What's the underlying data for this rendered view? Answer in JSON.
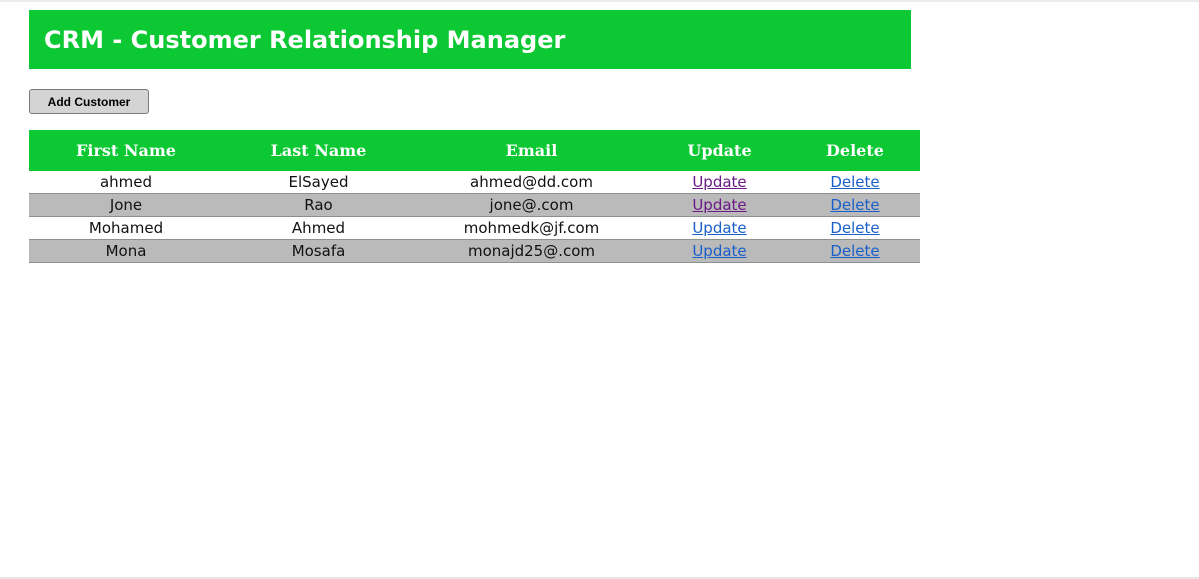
{
  "header": {
    "title": "CRM - Customer Relationship Manager"
  },
  "toolbar": {
    "add_label": "Add Customer"
  },
  "table": {
    "columns": [
      "First Name",
      "Last Name",
      "Email",
      "Update",
      "Delete"
    ],
    "rows": [
      {
        "first_name": "ahmed",
        "last_name": "ElSayed",
        "email": "ahmed@dd.com",
        "update": "Update",
        "delete": "Delete"
      },
      {
        "first_name": "Jone",
        "last_name": "Rao",
        "email": "jone@.com",
        "update": "Update",
        "delete": "Delete"
      },
      {
        "first_name": "Mohamed",
        "last_name": "Ahmed",
        "email": "mohmedk@jf.com",
        "update": "Update",
        "delete": "Delete"
      },
      {
        "first_name": "Mona",
        "last_name": "Mosafa",
        "email": "monajd25@.com",
        "update": "Update",
        "delete": "Delete"
      }
    ]
  },
  "colors": {
    "accent": "#0bc833",
    "row_alt": "#bababa",
    "link": "#1a5fc9",
    "link_visited": "#6b1a86"
  }
}
